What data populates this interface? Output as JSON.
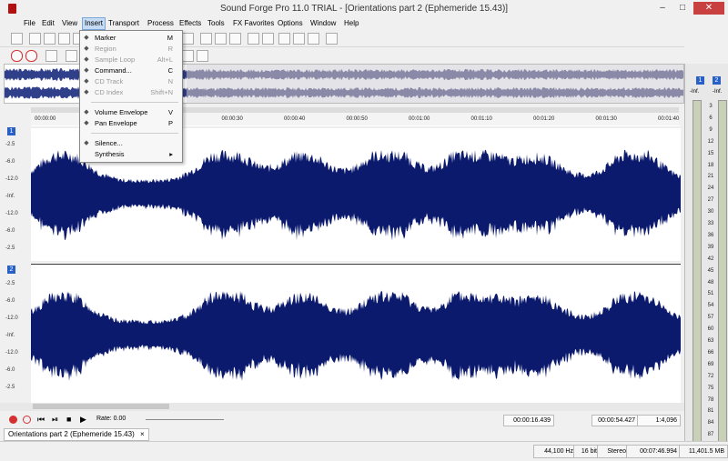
{
  "app": {
    "title": "Sound Forge Pro 11.0 TRIAL - [Orientations part 2 (Ephemeride 15.43)]"
  },
  "window_controls": {
    "minimize": "–",
    "maximize": "□",
    "close": "✕"
  },
  "menu": [
    "File",
    "Edit",
    "View",
    "Insert",
    "Transport",
    "Process",
    "Effects",
    "Tools",
    "FX Favorites",
    "Options",
    "Window",
    "Help"
  ],
  "insert_menu": [
    {
      "label": "Marker",
      "shortcut": "M",
      "enabled": true,
      "icon": "marker-icon"
    },
    {
      "label": "Region",
      "shortcut": "R",
      "enabled": false,
      "icon": "region-icon"
    },
    {
      "label": "Sample Loop",
      "shortcut": "Alt+L",
      "enabled": false,
      "icon": "loop-icon"
    },
    {
      "label": "Command...",
      "shortcut": "C",
      "enabled": true,
      "icon": "command-icon"
    },
    {
      "label": "CD Track",
      "shortcut": "N",
      "enabled": false,
      "icon": "cd-track-icon"
    },
    {
      "label": "CD Index",
      "shortcut": "Shift+N",
      "enabled": false,
      "icon": "cd-index-icon"
    },
    {
      "label": "Volume Envelope",
      "shortcut": "V",
      "enabled": true,
      "icon": "volume-envelope-icon"
    },
    {
      "label": "Pan Envelope",
      "shortcut": "P",
      "enabled": true,
      "icon": "pan-envelope-icon"
    },
    {
      "label": "Silence...",
      "shortcut": "",
      "enabled": true,
      "icon": "silence-icon"
    },
    {
      "label": "Synthesis",
      "shortcut": "▸",
      "enabled": true,
      "icon": ""
    }
  ],
  "ruler": {
    "labels": [
      "00:00:00",
      "00:00:10",
      "00:00:20",
      "00:00:30",
      "00:00:40",
      "00:00:50",
      "00:01:00",
      "00:01:10",
      "00:01:20",
      "00:01:30",
      "00:01:40"
    ]
  },
  "channel1": {
    "number": "1",
    "db_labels": [
      "-2.5",
      "-6.0",
      "-12.0",
      "-Inf.",
      "-12.0",
      "-6.0",
      "-2.5"
    ]
  },
  "channel2": {
    "number": "2",
    "db_labels": [
      "-2.5",
      "-6.0",
      "-12.0",
      "-Inf.",
      "-12.0",
      "-6.0",
      "-2.5"
    ]
  },
  "meters": {
    "top_left": "1",
    "top_right": "2",
    "peak_l": "-Inf.",
    "peak_r": "-Inf.",
    "scale": [
      "3",
      "6",
      "9",
      "12",
      "15",
      "18",
      "21",
      "24",
      "27",
      "30",
      "33",
      "36",
      "39",
      "42",
      "45",
      "48",
      "51",
      "54",
      "57",
      "60",
      "63",
      "66",
      "69",
      "72",
      "75",
      "78",
      "81",
      "84",
      "87"
    ]
  },
  "transport_bottom": {
    "rate_label": "Rate: 0.00",
    "time_pos": "00:00:16.439",
    "time_len": "00:00:54.427",
    "zoom": "1:4,096"
  },
  "doc_tab": {
    "label": "Orientations part 2 (Ephemeride 15.43)",
    "close": "×"
  },
  "status": {
    "sample_rate": "44,100 Hz",
    "bit_depth": "16 bit",
    "channels": "Stereo",
    "length": "00:07:46.994",
    "size": "11,401.5 MB"
  },
  "colors": {
    "wave": "#0c1a6e",
    "accent": "#2860c8",
    "selection": "#c6dcf4"
  }
}
